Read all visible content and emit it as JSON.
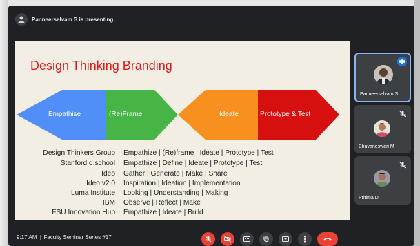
{
  "window": {
    "presenting": "Panneerselvam S is presenting"
  },
  "slide": {
    "title": "Design Thinking Branding",
    "bands": [
      "Empathise",
      "(Re)Frame",
      "Ideate",
      "Prototype & Test"
    ],
    "band_colors": [
      "#4f8ff7",
      "#47b545",
      "#f7901e",
      "#d80f0f"
    ],
    "rows": [
      {
        "org": "Design Thinkers Group",
        "steps": "Empathize | (Re)frame | Ideate | Prototype | Test"
      },
      {
        "org": "Stanford d.school",
        "steps": "Empathize | Define | Ideate | Prototype | Test"
      },
      {
        "org": "Ideo",
        "steps": "Gather | Generate | Make | Share"
      },
      {
        "org": "Ideo v2.0",
        "steps": "Inspiration | Ideation | Implementation"
      },
      {
        "org": "Luma Institute",
        "steps": "Looking | Understanding | Making"
      },
      {
        "org": "IBM",
        "steps": "Observe | Reflect | Make"
      },
      {
        "org": "FSU Innovation Hub",
        "steps": "Empathize | Ideate | Build"
      }
    ]
  },
  "participants": [
    {
      "name": "Panneerselvam S",
      "state": "speaking"
    },
    {
      "name": "Bhuvaneswari M",
      "state": "muted"
    },
    {
      "name": "Pritima D",
      "state": "muted"
    }
  ],
  "bottombar": {
    "time": "9:17 AM",
    "meeting_title": "Faculty Seminar Series #17",
    "controls": [
      "mic-off-icon",
      "camera-off-icon",
      "captions-icon",
      "raise-hand-icon",
      "present-icon",
      "more-options-icon",
      "end-call-icon"
    ]
  }
}
